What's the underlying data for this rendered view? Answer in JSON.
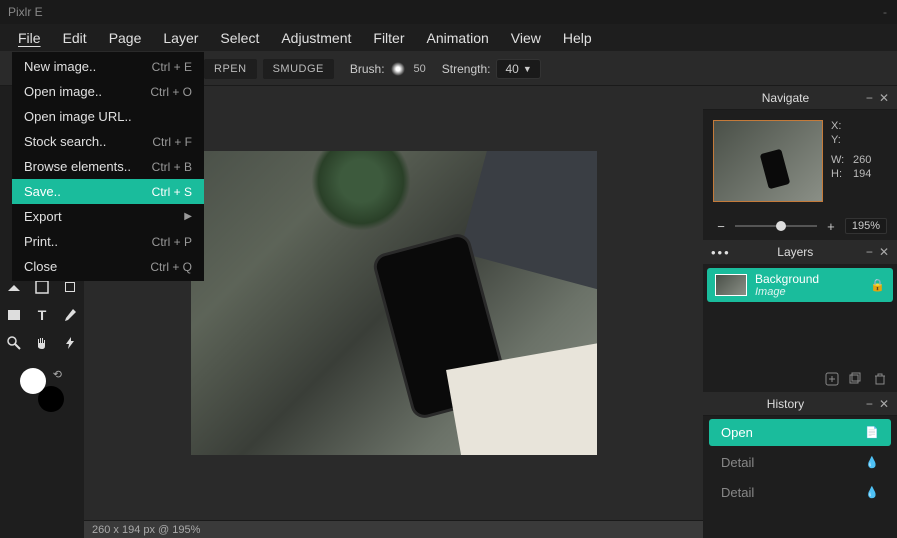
{
  "app": {
    "title": "Pixlr E"
  },
  "menubar": [
    "File",
    "Edit",
    "Page",
    "Layer",
    "Select",
    "Adjustment",
    "Filter",
    "Animation",
    "View",
    "Help"
  ],
  "file_menu": [
    {
      "label": "New image..",
      "shortcut": "Ctrl + E"
    },
    {
      "label": "Open image..",
      "shortcut": "Ctrl + O"
    },
    {
      "label": "Open image URL..",
      "shortcut": ""
    },
    {
      "label": "Stock search..",
      "shortcut": "Ctrl + F"
    },
    {
      "label": "Browse elements..",
      "shortcut": "Ctrl + B"
    },
    {
      "label": "Save..",
      "shortcut": "Ctrl + S",
      "highlight": true
    },
    {
      "label": "Export",
      "shortcut": "",
      "submenu": true
    },
    {
      "label": "Print..",
      "shortcut": "Ctrl + P"
    },
    {
      "label": "Close",
      "shortcut": "Ctrl + Q"
    }
  ],
  "toolbar": {
    "modes": [
      "RPEN",
      "SMUDGE"
    ],
    "brush_label": "Brush:",
    "brush_size": "50",
    "strength_label": "Strength:",
    "strength_value": "40"
  },
  "navigate": {
    "title": "Navigate",
    "x_label": "X:",
    "y_label": "Y:",
    "w_label": "W:",
    "h_label": "H:",
    "w_value": "260",
    "h_value": "194",
    "zoom": "195%"
  },
  "layers": {
    "title": "Layers",
    "items": [
      {
        "name": "Background",
        "type": "Image"
      }
    ]
  },
  "history": {
    "title": "History",
    "items": [
      {
        "label": "Open",
        "active": true
      },
      {
        "label": "Detail"
      },
      {
        "label": "Detail"
      }
    ]
  },
  "status": {
    "text": "260 x 194 px @ 195%"
  }
}
